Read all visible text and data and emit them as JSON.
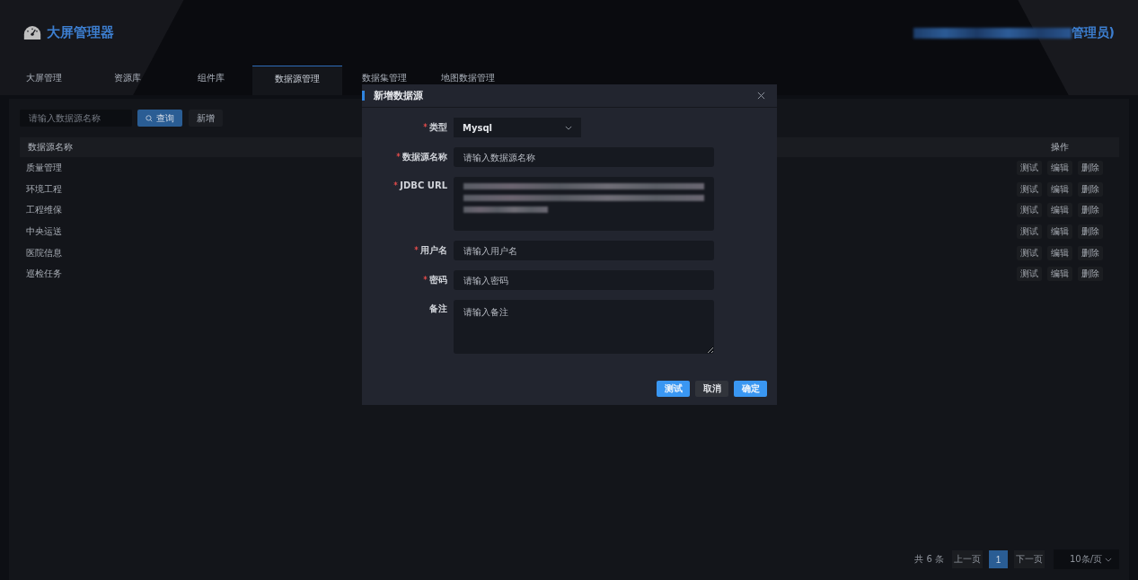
{
  "header": {
    "title": "大屏管理器",
    "user_redacted": true,
    "user": "管理员)"
  },
  "tabs": [
    {
      "label": "大屏管理",
      "selected": false
    },
    {
      "label": "资源库",
      "selected": false
    },
    {
      "label": "组件库",
      "selected": false
    },
    {
      "label": "数据源管理",
      "selected": true
    },
    {
      "label": "数据集管理",
      "selected": false
    },
    {
      "label": "地图数据管理",
      "selected": false
    }
  ],
  "toolbar": {
    "search_placeholder": "请输入数据源名称",
    "search_button": "查询",
    "add_button": "新增"
  },
  "table": {
    "columns": [
      "数据源名称",
      "操作"
    ],
    "rows": [
      {
        "name": "质量管理",
        "actions": [
          "测试",
          "编辑",
          "删除"
        ]
      },
      {
        "name": "环境工程",
        "actions": [
          "测试",
          "编辑",
          "删除"
        ]
      },
      {
        "name": "工程维保",
        "actions": [
          "测试",
          "编辑",
          "删除"
        ]
      },
      {
        "name": "中央运送",
        "actions": [
          "测试",
          "编辑",
          "删除"
        ]
      },
      {
        "name": "医院信息",
        "actions": [
          "测试",
          "编辑",
          "删除"
        ]
      },
      {
        "name": "巡检任务",
        "actions": [
          "测试",
          "编辑",
          "删除"
        ]
      }
    ]
  },
  "pagination": {
    "total": "共 6 条",
    "prev": "上一页",
    "pages": [
      {
        "label": "1",
        "selected": true
      }
    ],
    "next": "下一页",
    "page_size": "10条/页"
  },
  "dialog": {
    "title": "新增数据源",
    "fields": [
      {
        "kind": "select",
        "label": "类型",
        "required": true,
        "value": "Mysql"
      },
      {
        "kind": "input",
        "label": "数据源名称",
        "required": true,
        "placeholder": "请输入数据源名称"
      },
      {
        "kind": "textarea",
        "label": "JDBC URL",
        "required": true,
        "redacted": true
      },
      {
        "kind": "input",
        "label": "用户名",
        "required": true,
        "placeholder": "请输入用户名"
      },
      {
        "kind": "input",
        "label": "密码",
        "required": true,
        "placeholder": "请输入密码"
      },
      {
        "kind": "textarea",
        "label": "备注",
        "required": false,
        "placeholder": "请输入备注"
      }
    ],
    "buttons": [
      {
        "label": "测试",
        "kind": "primary"
      },
      {
        "label": "取消",
        "kind": "default"
      },
      {
        "label": "确定",
        "kind": "primary"
      }
    ]
  }
}
